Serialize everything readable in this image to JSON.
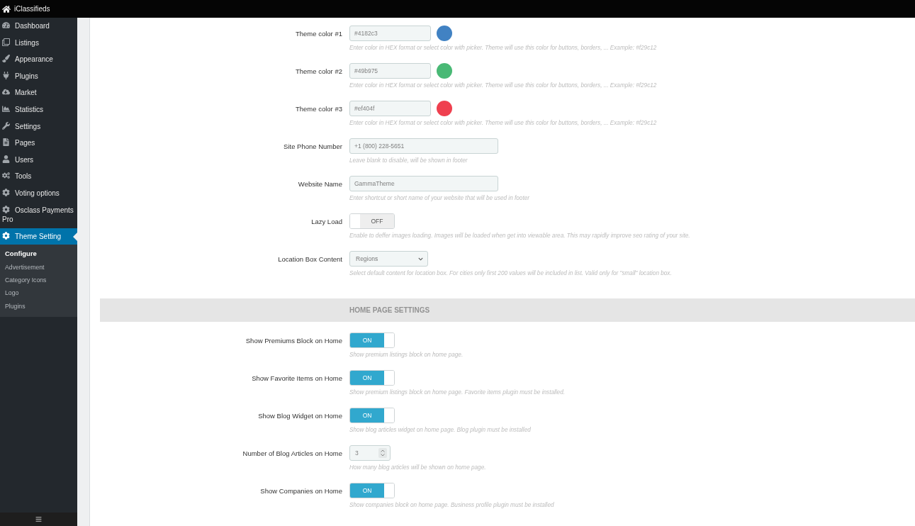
{
  "top_bar": {
    "site_title": "iClassifieds"
  },
  "sidebar": {
    "items": [
      {
        "label": "Dashboard",
        "selected": false
      },
      {
        "label": "Listings",
        "selected": false
      },
      {
        "label": "Appearance",
        "selected": false
      },
      {
        "label": "Plugins",
        "selected": false
      },
      {
        "label": "Market",
        "selected": false
      },
      {
        "label": "Statistics",
        "selected": false
      },
      {
        "label": "Settings",
        "selected": false
      },
      {
        "label": "Pages",
        "selected": false
      },
      {
        "label": "Users",
        "selected": false
      },
      {
        "label": "Tools",
        "selected": false
      },
      {
        "label": "Voting options",
        "selected": false
      },
      {
        "label": "Osclass Payments Pro",
        "selected": false
      },
      {
        "label": "Theme Setting",
        "selected": true,
        "children": [
          {
            "label": "Configure",
            "selected": true
          },
          {
            "label": "Advertisement",
            "selected": false
          },
          {
            "label": "Category Icons",
            "selected": false
          },
          {
            "label": "Logo",
            "selected": false
          },
          {
            "label": "Plugins",
            "selected": false
          }
        ]
      }
    ]
  },
  "sections": [
    {
      "settings": [
        {
          "kind": "color",
          "label": "Theme color #1",
          "value": "#4182c3",
          "color": "#4182c3",
          "hint": "Enter color in HEX format or select color with picker. Theme will use this color for buttons, borders, ... Example: #f29c12"
        },
        {
          "kind": "color",
          "label": "Theme color #2",
          "value": "#49b975",
          "color": "#49b975",
          "hint": "Enter color in HEX format or select color with picker. Theme will use this color for buttons, borders, ... Example: #f29c12"
        },
        {
          "kind": "color",
          "label": "Theme color #3",
          "value": "#ef404f",
          "color": "#ef404f",
          "hint": "Enter color in HEX format or select color with picker. Theme will use this color for buttons, borders, ... Example: #f29c12"
        },
        {
          "kind": "text",
          "label": "Site Phone Number",
          "value": "+1 (800) 228-5651",
          "hint": "Leave blank to disable, will be shown in footer"
        },
        {
          "kind": "text",
          "label": "Website Name",
          "value": "GammaTheme",
          "hint": "Enter shortcut or short name of your website that will be used in footer"
        },
        {
          "kind": "toggle",
          "label": "Lazy Load",
          "on": false,
          "state_label": "OFF",
          "hint": "Enable to deffer images loading. Images will be loaded when get into viewable area. This may rapidly improve seo rating of your site."
        },
        {
          "kind": "select",
          "label": "Location Box Content",
          "value": "Regions",
          "hint": "Select default content for location box. For cities only first 200 values will be included in list. Valid only for \"small\" location box."
        }
      ]
    },
    {
      "heading": "HOME PAGE SETTINGS",
      "settings": [
        {
          "kind": "toggle",
          "label": "Show Premiums Block on Home",
          "on": true,
          "state_label": "ON",
          "hint": "Show premium listings block on home page."
        },
        {
          "kind": "toggle",
          "label": "Show Favorite Items on Home",
          "on": true,
          "state_label": "ON",
          "hint": "Show premium listings block on home page. Favorite items plugin must be installed."
        },
        {
          "kind": "toggle",
          "label": "Show Blog Widget on Home",
          "on": true,
          "state_label": "ON",
          "hint": "Show blog articles widget on home page. Blog plugin must be installed"
        },
        {
          "kind": "number",
          "label": "Number of Blog Articles on Home",
          "value": "3",
          "hint": "How many blog articles will be shown on home page."
        },
        {
          "kind": "toggle",
          "label": "Show Companies on Home",
          "on": true,
          "state_label": "ON",
          "hint": "Show companies block on home page. Business profile plugin must be installed"
        }
      ]
    }
  ]
}
